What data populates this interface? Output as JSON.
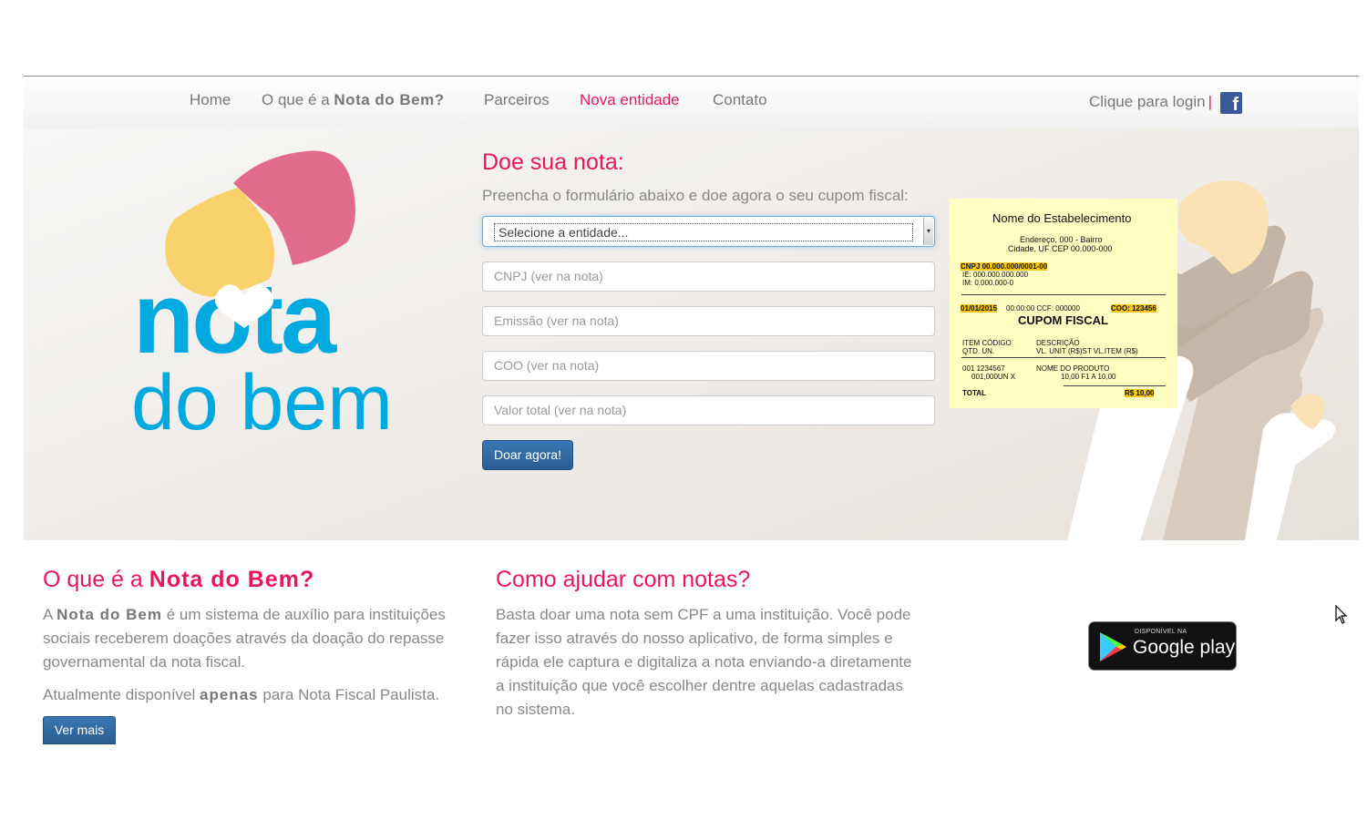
{
  "nav": {
    "home": "Home",
    "about_prefix": "O que é a",
    "about_brand": "Nota do Bem?",
    "partners": "Parceiros",
    "new_entity": "Nova entidade",
    "contact": "Contato",
    "login": "Clique para login",
    "login_separator": "|"
  },
  "logo": {
    "line1": "nota",
    "line2": "do bem"
  },
  "form": {
    "title": "Doe sua nota:",
    "subtitle": "Preencha o formulário abaixo e doe agora o seu cupom fiscal:",
    "select_value": "Selecione a entidade...",
    "cnpj_placeholder": "CNPJ (ver na nota)",
    "emissao_placeholder": "Emissão (ver na nota)",
    "coo_placeholder": "COO (ver na nota)",
    "valor_placeholder": "Valor total (ver na nota)",
    "submit_label": "Doar agora!"
  },
  "receipt": {
    "store": "Nome do Estabelecimento",
    "address": "Endereço, 000 - Bairro",
    "city": "Cidade, UF CEP 00.000-000",
    "cnpj": "CNPJ 00.000.000/0001-00",
    "ie": "IE: 000.000.000.000",
    "im": "IM: 0.000.000-0",
    "date": "01/01/2015",
    "time_ccf": "00:00:00 CCF: 000000",
    "coo": "COO: 123456",
    "title": "CUPOM FISCAL",
    "hdr1": "ITEM  CÓDIGO",
    "hdr1b": "DESCRIÇÃO",
    "hdr2": "QTD.  UN.",
    "hdr2b": "VL. UNIT (R$)ST    VL.ITEM (R$)",
    "item1": "001     1234567",
    "item1b": "NOME DO PRODUTO",
    "item2": "001,000UN       X",
    "item2b": "10,00     F1   A          10,00",
    "total_label": "TOTAL",
    "total_value": "R$ 10,00"
  },
  "about": {
    "title_prefix": "O que é a",
    "title_brand": "Nota do Bem?",
    "p1_prefix": "A",
    "p1_brand": "Nota do Bem",
    "p1_rest": "é um sistema de auxílio para instituições sociais receberem doações através da doação do repasse governamental da nota fiscal.",
    "p2_prefix": "Atualmente disponível",
    "p2_bold": "apenas",
    "p2_rest": "para Nota Fiscal Paulista.",
    "button": "Ver mais"
  },
  "help": {
    "title": "Como ajudar com notas?",
    "text": "Basta doar uma nota sem CPF a uma instituição. Você pode fazer isso através do nosso aplicativo, de forma simples e rápida ele captura e digitaliza a nota enviando-a diretamente a instituição que você escolher dentre aquelas cadastradas no sistema."
  },
  "google_play": {
    "small": "DISPONÍVEL NA",
    "big": "Google play"
  },
  "colors": {
    "accent": "#e8175d",
    "brand_blue": "#00a9e0",
    "button_blue": "#2a5d90",
    "receipt_bg": "#fffcc2"
  },
  "icons": {
    "facebook": "facebook-icon",
    "play": "google-play-icon",
    "cursor": "mouse-cursor-icon"
  }
}
